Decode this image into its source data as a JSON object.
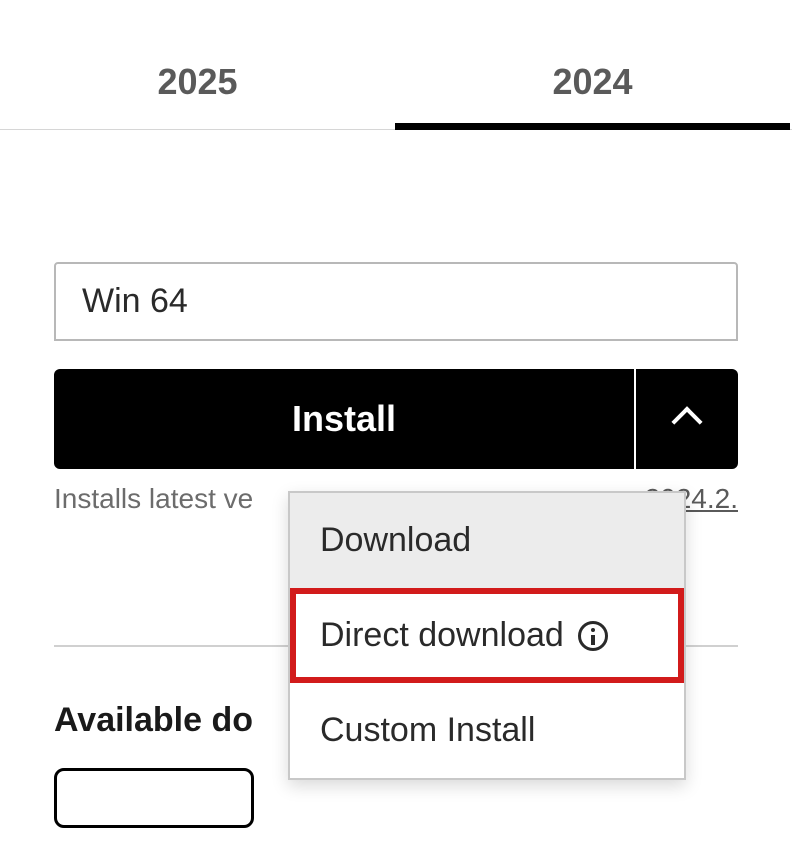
{
  "tabs": [
    {
      "label": "2025",
      "active": false
    },
    {
      "label": "2024",
      "active": true
    }
  ],
  "platform_select": {
    "value": "Win 64"
  },
  "install_button": {
    "label": "Install"
  },
  "hint": {
    "left": "Installs latest ve",
    "right": "2024.2."
  },
  "menu": {
    "items": [
      {
        "label": "Download",
        "hover": true,
        "highlight": false,
        "info": false
      },
      {
        "label": "Direct download",
        "hover": false,
        "highlight": true,
        "info": true
      },
      {
        "label": "Custom Install",
        "hover": false,
        "highlight": false,
        "info": false
      }
    ]
  },
  "section": {
    "title": "Available do"
  }
}
